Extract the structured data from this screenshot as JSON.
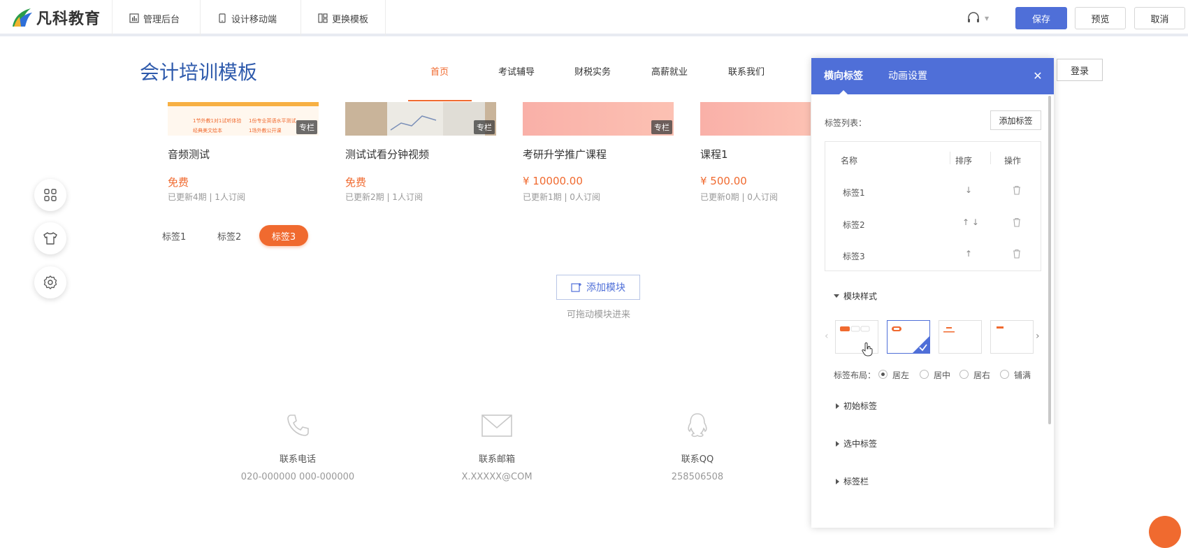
{
  "topbar": {
    "brand": "凡科教育",
    "nav": [
      {
        "label": "管理后台",
        "icon": "chart-icon"
      },
      {
        "label": "设计移动端",
        "icon": "mobile-icon"
      },
      {
        "label": "更换模板",
        "icon": "template-icon"
      }
    ],
    "save_label": "保存",
    "preview_label": "预览",
    "cancel_label": "取消"
  },
  "site": {
    "title": "会计培训模板",
    "nav": [
      "首页",
      "考试辅导",
      "财税实务",
      "高薪就业",
      "联系我们"
    ],
    "active_nav": "首页",
    "login_label": "登录"
  },
  "courses": [
    {
      "title": "音频测试",
      "price": "免费",
      "meta": "已更新4期 | 1人订阅",
      "badge": "专栏"
    },
    {
      "title": "测试试看分钟视频",
      "price": "免费",
      "meta": "已更新2期 | 1人订阅",
      "badge": "专栏"
    },
    {
      "title": "考研升学推广课程",
      "price": "¥ 10000.00",
      "meta": "已更新1期 | 0人订阅",
      "badge": "专栏"
    },
    {
      "title": "课程1",
      "price": "¥ 500.00",
      "meta": "已更新0期 | 0人订阅",
      "badge": ""
    }
  ],
  "thumb1_text": [
    "1节外教1对1试听体验",
    "1份专业英语水平测试",
    "经典美文绘本",
    "1场外教公开课"
  ],
  "tabs": [
    "标签1",
    "标签2",
    "标签3"
  ],
  "active_tab": "标签3",
  "module": {
    "add_label": "添加模块",
    "hint": "可拖动模块进来"
  },
  "contacts": [
    {
      "label": "联系电话",
      "value": "020-000000 000-000000",
      "icon": "phone-icon"
    },
    {
      "label": "联系邮箱",
      "value": "X.XXXXX@COM",
      "icon": "mail-icon"
    },
    {
      "label": "联系QQ",
      "value": "258506508",
      "icon": "qq-icon"
    }
  ],
  "side_tools": [
    "grid-icon",
    "shirt-icon",
    "gear-icon"
  ],
  "panel": {
    "tabs": [
      "横向标签",
      "动画设置"
    ],
    "active_tab": "横向标签",
    "tag_list_label": "标签列表：",
    "add_tag_label": "添加标签",
    "columns": [
      "名称",
      "排序",
      "操作"
    ],
    "rows": [
      {
        "name": "标签1",
        "sort": "↓"
      },
      {
        "name": "标签2",
        "sort": "↑ ↓"
      },
      {
        "name": "标签3",
        "sort": "↑"
      }
    ],
    "module_style_label": "模块样式",
    "layout_label": "标签布局：",
    "layout_options": [
      "居左",
      "居中",
      "居右",
      "铺满"
    ],
    "layout_selected": "居左",
    "sections": [
      "初始标签",
      "选中标签",
      "标签栏"
    ]
  },
  "colors": {
    "accent": "#4f6fd8",
    "orange": "#f06a2f",
    "title_blue": "#2e5aac"
  }
}
